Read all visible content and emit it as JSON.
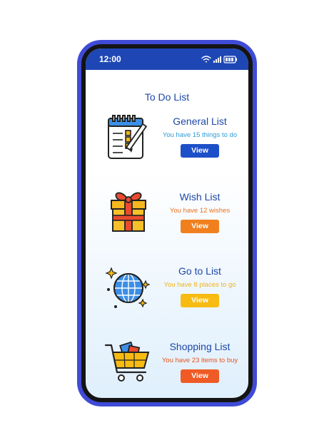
{
  "status": {
    "time": "12:00"
  },
  "header": {
    "title": "To Do List"
  },
  "lists": [
    {
      "title": "General List",
      "subtitle": "You have 15 things to do",
      "button": "View",
      "icon": "checklist-icon",
      "text_color": "#2d9ad9",
      "button_color": "#1d4fc9"
    },
    {
      "title": "Wish List",
      "subtitle": "You have 12  wishes",
      "button": "View",
      "icon": "gift-icon",
      "text_color": "#e8701c",
      "button_color": "#f0801e"
    },
    {
      "title": "Go to List",
      "subtitle": "You have 8 places to go",
      "button": "View",
      "icon": "globe-icon",
      "text_color": "#f0b21c",
      "button_color": "#f7bb12"
    },
    {
      "title": "Shopping List",
      "subtitle": "You have 23 items to buy",
      "button": "View",
      "icon": "shopping-cart-icon",
      "text_color": "#e8531c",
      "button_color": "#ef5a25"
    }
  ]
}
